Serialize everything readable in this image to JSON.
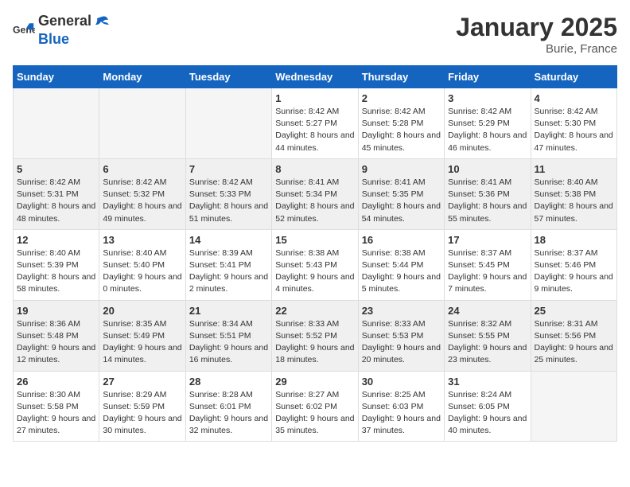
{
  "logo": {
    "text_general": "General",
    "text_blue": "Blue"
  },
  "header": {
    "month_year": "January 2025",
    "location": "Burie, France"
  },
  "weekdays": [
    "Sunday",
    "Monday",
    "Tuesday",
    "Wednesday",
    "Thursday",
    "Friday",
    "Saturday"
  ],
  "weeks": [
    [
      {
        "day": "",
        "sunrise": "",
        "sunset": "",
        "daylight": "",
        "empty": true
      },
      {
        "day": "",
        "sunrise": "",
        "sunset": "",
        "daylight": "",
        "empty": true
      },
      {
        "day": "",
        "sunrise": "",
        "sunset": "",
        "daylight": "",
        "empty": true
      },
      {
        "day": "1",
        "sunrise": "Sunrise: 8:42 AM",
        "sunset": "Sunset: 5:27 PM",
        "daylight": "Daylight: 8 hours and 44 minutes.",
        "empty": false
      },
      {
        "day": "2",
        "sunrise": "Sunrise: 8:42 AM",
        "sunset": "Sunset: 5:28 PM",
        "daylight": "Daylight: 8 hours and 45 minutes.",
        "empty": false
      },
      {
        "day": "3",
        "sunrise": "Sunrise: 8:42 AM",
        "sunset": "Sunset: 5:29 PM",
        "daylight": "Daylight: 8 hours and 46 minutes.",
        "empty": false
      },
      {
        "day": "4",
        "sunrise": "Sunrise: 8:42 AM",
        "sunset": "Sunset: 5:30 PM",
        "daylight": "Daylight: 8 hours and 47 minutes.",
        "empty": false
      }
    ],
    [
      {
        "day": "5",
        "sunrise": "Sunrise: 8:42 AM",
        "sunset": "Sunset: 5:31 PM",
        "daylight": "Daylight: 8 hours and 48 minutes.",
        "empty": false
      },
      {
        "day": "6",
        "sunrise": "Sunrise: 8:42 AM",
        "sunset": "Sunset: 5:32 PM",
        "daylight": "Daylight: 8 hours and 49 minutes.",
        "empty": false
      },
      {
        "day": "7",
        "sunrise": "Sunrise: 8:42 AM",
        "sunset": "Sunset: 5:33 PM",
        "daylight": "Daylight: 8 hours and 51 minutes.",
        "empty": false
      },
      {
        "day": "8",
        "sunrise": "Sunrise: 8:41 AM",
        "sunset": "Sunset: 5:34 PM",
        "daylight": "Daylight: 8 hours and 52 minutes.",
        "empty": false
      },
      {
        "day": "9",
        "sunrise": "Sunrise: 8:41 AM",
        "sunset": "Sunset: 5:35 PM",
        "daylight": "Daylight: 8 hours and 54 minutes.",
        "empty": false
      },
      {
        "day": "10",
        "sunrise": "Sunrise: 8:41 AM",
        "sunset": "Sunset: 5:36 PM",
        "daylight": "Daylight: 8 hours and 55 minutes.",
        "empty": false
      },
      {
        "day": "11",
        "sunrise": "Sunrise: 8:40 AM",
        "sunset": "Sunset: 5:38 PM",
        "daylight": "Daylight: 8 hours and 57 minutes.",
        "empty": false
      }
    ],
    [
      {
        "day": "12",
        "sunrise": "Sunrise: 8:40 AM",
        "sunset": "Sunset: 5:39 PM",
        "daylight": "Daylight: 8 hours and 58 minutes.",
        "empty": false
      },
      {
        "day": "13",
        "sunrise": "Sunrise: 8:40 AM",
        "sunset": "Sunset: 5:40 PM",
        "daylight": "Daylight: 9 hours and 0 minutes.",
        "empty": false
      },
      {
        "day": "14",
        "sunrise": "Sunrise: 8:39 AM",
        "sunset": "Sunset: 5:41 PM",
        "daylight": "Daylight: 9 hours and 2 minutes.",
        "empty": false
      },
      {
        "day": "15",
        "sunrise": "Sunrise: 8:38 AM",
        "sunset": "Sunset: 5:43 PM",
        "daylight": "Daylight: 9 hours and 4 minutes.",
        "empty": false
      },
      {
        "day": "16",
        "sunrise": "Sunrise: 8:38 AM",
        "sunset": "Sunset: 5:44 PM",
        "daylight": "Daylight: 9 hours and 5 minutes.",
        "empty": false
      },
      {
        "day": "17",
        "sunrise": "Sunrise: 8:37 AM",
        "sunset": "Sunset: 5:45 PM",
        "daylight": "Daylight: 9 hours and 7 minutes.",
        "empty": false
      },
      {
        "day": "18",
        "sunrise": "Sunrise: 8:37 AM",
        "sunset": "Sunset: 5:46 PM",
        "daylight": "Daylight: 9 hours and 9 minutes.",
        "empty": false
      }
    ],
    [
      {
        "day": "19",
        "sunrise": "Sunrise: 8:36 AM",
        "sunset": "Sunset: 5:48 PM",
        "daylight": "Daylight: 9 hours and 12 minutes.",
        "empty": false
      },
      {
        "day": "20",
        "sunrise": "Sunrise: 8:35 AM",
        "sunset": "Sunset: 5:49 PM",
        "daylight": "Daylight: 9 hours and 14 minutes.",
        "empty": false
      },
      {
        "day": "21",
        "sunrise": "Sunrise: 8:34 AM",
        "sunset": "Sunset: 5:51 PM",
        "daylight": "Daylight: 9 hours and 16 minutes.",
        "empty": false
      },
      {
        "day": "22",
        "sunrise": "Sunrise: 8:33 AM",
        "sunset": "Sunset: 5:52 PM",
        "daylight": "Daylight: 9 hours and 18 minutes.",
        "empty": false
      },
      {
        "day": "23",
        "sunrise": "Sunrise: 8:33 AM",
        "sunset": "Sunset: 5:53 PM",
        "daylight": "Daylight: 9 hours and 20 minutes.",
        "empty": false
      },
      {
        "day": "24",
        "sunrise": "Sunrise: 8:32 AM",
        "sunset": "Sunset: 5:55 PM",
        "daylight": "Daylight: 9 hours and 23 minutes.",
        "empty": false
      },
      {
        "day": "25",
        "sunrise": "Sunrise: 8:31 AM",
        "sunset": "Sunset: 5:56 PM",
        "daylight": "Daylight: 9 hours and 25 minutes.",
        "empty": false
      }
    ],
    [
      {
        "day": "26",
        "sunrise": "Sunrise: 8:30 AM",
        "sunset": "Sunset: 5:58 PM",
        "daylight": "Daylight: 9 hours and 27 minutes.",
        "empty": false
      },
      {
        "day": "27",
        "sunrise": "Sunrise: 8:29 AM",
        "sunset": "Sunset: 5:59 PM",
        "daylight": "Daylight: 9 hours and 30 minutes.",
        "empty": false
      },
      {
        "day": "28",
        "sunrise": "Sunrise: 8:28 AM",
        "sunset": "Sunset: 6:01 PM",
        "daylight": "Daylight: 9 hours and 32 minutes.",
        "empty": false
      },
      {
        "day": "29",
        "sunrise": "Sunrise: 8:27 AM",
        "sunset": "Sunset: 6:02 PM",
        "daylight": "Daylight: 9 hours and 35 minutes.",
        "empty": false
      },
      {
        "day": "30",
        "sunrise": "Sunrise: 8:25 AM",
        "sunset": "Sunset: 6:03 PM",
        "daylight": "Daylight: 9 hours and 37 minutes.",
        "empty": false
      },
      {
        "day": "31",
        "sunrise": "Sunrise: 8:24 AM",
        "sunset": "Sunset: 6:05 PM",
        "daylight": "Daylight: 9 hours and 40 minutes.",
        "empty": false
      },
      {
        "day": "",
        "sunrise": "",
        "sunset": "",
        "daylight": "",
        "empty": true
      }
    ]
  ]
}
